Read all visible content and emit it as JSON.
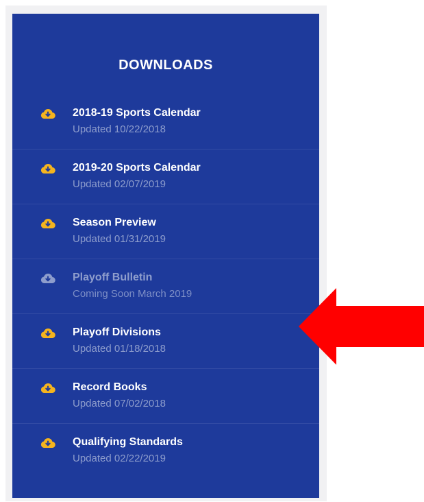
{
  "panel": {
    "title": "DOWNLOADS",
    "background_color": "#1e3a9b",
    "icon_color_active": "#f5b41e",
    "icon_color_disabled": "#8e9dcc"
  },
  "downloads": [
    {
      "name": "2018-19 Sports Calendar",
      "status": "Updated 10/22/2018",
      "available": true,
      "icon": "cloud-download-icon"
    },
    {
      "name": "2019-20 Sports Calendar",
      "status": "Updated 02/07/2019",
      "available": true,
      "icon": "cloud-download-icon"
    },
    {
      "name": "Season Preview",
      "status": "Updated 01/31/2019",
      "available": true,
      "icon": "cloud-download-icon"
    },
    {
      "name": "Playoff Bulletin",
      "status": "Coming Soon March 2019",
      "available": false,
      "icon": "cloud-download-icon"
    },
    {
      "name": "Playoff Divisions",
      "status": "Updated 01/18/2018",
      "available": true,
      "icon": "cloud-download-icon"
    },
    {
      "name": "Record Books",
      "status": "Updated 07/02/2018",
      "available": true,
      "icon": "cloud-download-icon"
    },
    {
      "name": "Qualifying Standards",
      "status": "Updated 02/22/2019",
      "available": true,
      "icon": "cloud-download-icon"
    }
  ],
  "annotation": {
    "icon": "left-arrow-icon",
    "color": "#ff0000"
  }
}
